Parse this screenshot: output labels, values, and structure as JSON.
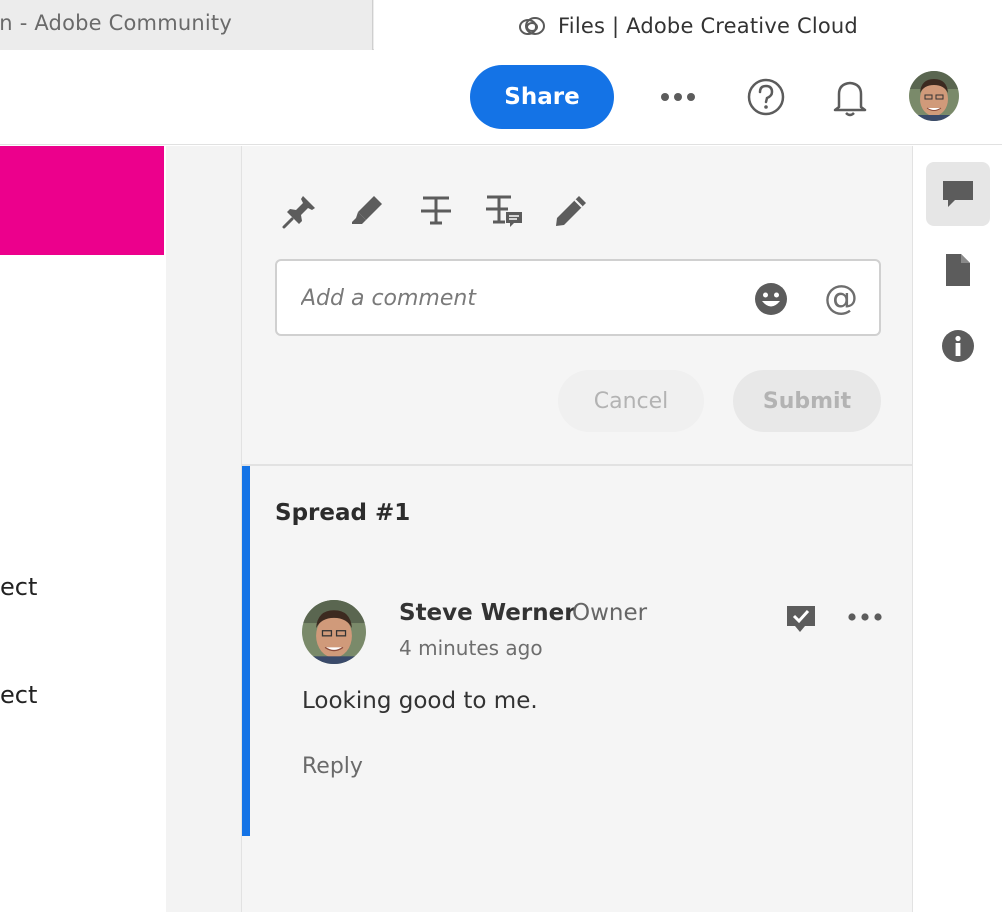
{
  "browser": {
    "tabs": [
      {
        "title": "gn - Adobe Community",
        "active": false
      },
      {
        "title": "Files | Adobe Creative Cloud",
        "active": true
      }
    ]
  },
  "header": {
    "share_label": "Share",
    "icons": [
      "more-icon",
      "help-icon",
      "bell-icon",
      "avatar"
    ]
  },
  "document": {
    "accent_color": "#ec008c",
    "text_fragments": [
      "ect",
      "ect"
    ]
  },
  "comments": {
    "tools": [
      "pin-icon",
      "highlighter-icon",
      "strikethrough-icon",
      "replace-text-icon",
      "pencil-icon"
    ],
    "input": {
      "placeholder": "Add a comment",
      "value": ""
    },
    "cancel_label": "Cancel",
    "submit_label": "Submit",
    "thread": {
      "title": "Spread #1",
      "comment": {
        "author": "Steve Werner",
        "role": "Owner",
        "time": "4 minutes ago",
        "text": "Looking good to me.",
        "reply_label": "Reply"
      }
    }
  },
  "rail": {
    "items": [
      "comments-icon",
      "file-icon",
      "info-icon"
    ],
    "active": "comments-icon"
  },
  "colors": {
    "primary": "#1473e6",
    "magenta": "#ec008c",
    "panel_bg": "#f5f5f5"
  }
}
